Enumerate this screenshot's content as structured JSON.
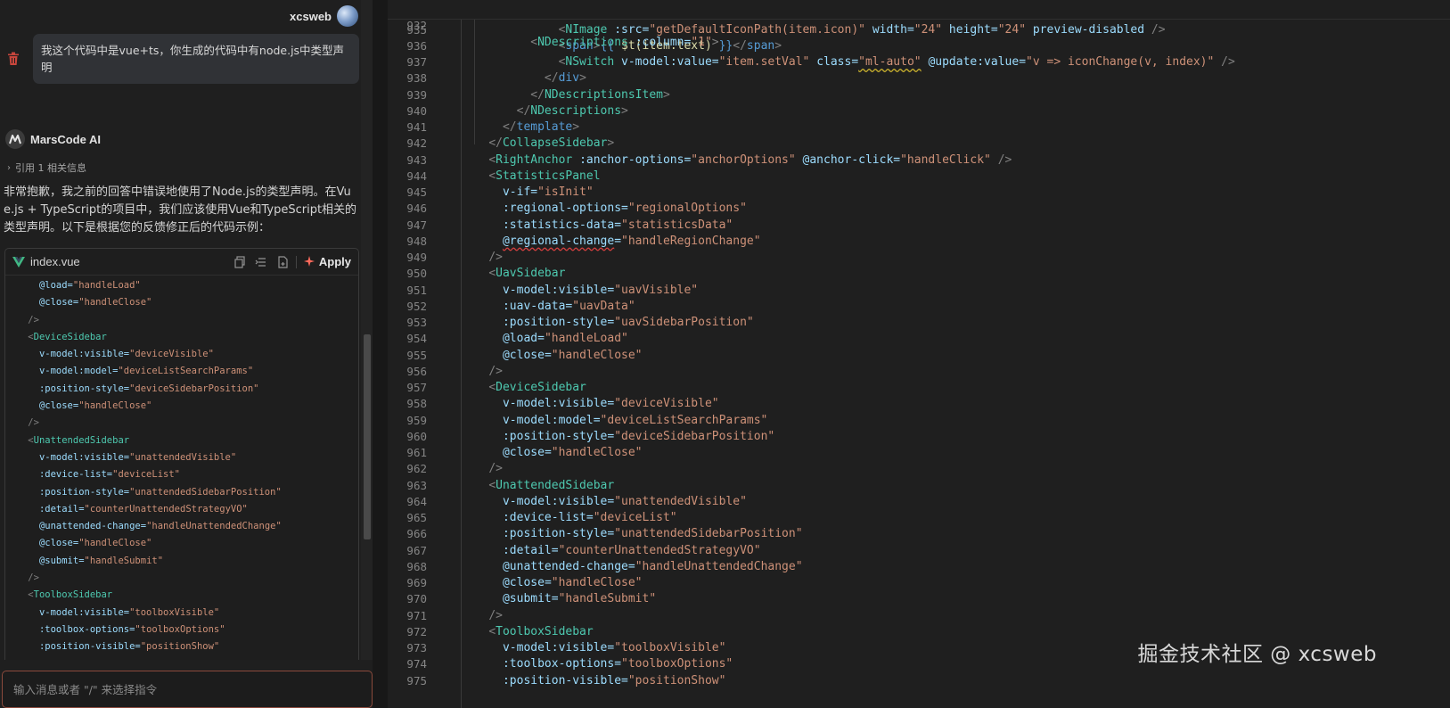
{
  "chat": {
    "user": {
      "name": "xcsweb",
      "message": "我这个代码中是vue+ts，你生成的代码中有node.js中类型声明"
    },
    "assistant": {
      "name": "MarsCode AI",
      "reference": "引用 1 相关信息",
      "reply": "非常抱歉，我之前的回答中错误地使用了Node.js的类型声明。在Vue.js + TypeScript的项目中，我们应该使用Vue和TypeScript相关的类型声明。以下是根据您的反馈修正后的代码示例："
    },
    "code_card": {
      "file_name": "index.vue",
      "apply_label": "Apply",
      "lines": [
        "      @load=\"handleLoad\"",
        "      @close=\"handleClose\"",
        "    />",
        "    <DeviceSidebar",
        "      v-model:visible=\"deviceVisible\"",
        "      v-model:model=\"deviceListSearchParams\"",
        "      :position-style=\"deviceSidebarPosition\"",
        "      @close=\"handleClose\"",
        "    />",
        "    <UnattendedSidebar",
        "      v-model:visible=\"unattendedVisible\"",
        "      :device-list=\"deviceList\"",
        "      :position-style=\"unattendedSidebarPosition\"",
        "      :detail=\"counterUnattendedStrategyVO\"",
        "      @unattended-change=\"handleUnattendedChange\"",
        "      @close=\"handleClose\"",
        "      @submit=\"handleSubmit\"",
        "    />",
        "    <ToolboxSidebar",
        "      v-model:visible=\"toolboxVisible\"",
        "      :toolbox-options=\"toolboxOptions\"",
        "      :position-visible=\"positionShow\""
      ]
    },
    "input_placeholder": "输入消息或者 \"/\" 来选择指令"
  },
  "editor": {
    "sticky": {
      "number": "932",
      "text": "          <NDescriptions :column=\"1\">"
    },
    "lines": [
      {
        "n": "935",
        "t": "              <NImage :src=\"getDefaultIconPath(item.icon)\" width=\"24\" height=\"24\" preview-disabled />"
      },
      {
        "n": "936",
        "t": "              <span>{{ $t(item.text) }}</span>"
      },
      {
        "n": "937",
        "t": "              <NSwitch v-model:value=\"item.setVal\" class=\"ml-auto\" @update:value=\"v => iconChange(v, index)\" />"
      },
      {
        "n": "938",
        "t": "            </div>"
      },
      {
        "n": "939",
        "t": "          </NDescriptionsItem>"
      },
      {
        "n": "940",
        "t": "        </NDescriptions>"
      },
      {
        "n": "941",
        "t": "      </template>"
      },
      {
        "n": "942",
        "t": "    </CollapseSidebar>"
      },
      {
        "n": "943",
        "t": "    <RightAnchor :anchor-options=\"anchorOptions\" @anchor-click=\"handleClick\" />"
      },
      {
        "n": "944",
        "t": "    <StatisticsPanel"
      },
      {
        "n": "945",
        "t": "      v-if=\"isInit\""
      },
      {
        "n": "946",
        "t": "      :regional-options=\"regionalOptions\""
      },
      {
        "n": "947",
        "t": "      :statistics-data=\"statisticsData\""
      },
      {
        "n": "948",
        "t": "      @regional-change=\"handleRegionChange\""
      },
      {
        "n": "949",
        "t": "    />"
      },
      {
        "n": "950",
        "t": "    <UavSidebar"
      },
      {
        "n": "951",
        "t": "      v-model:visible=\"uavVisible\""
      },
      {
        "n": "952",
        "t": "      :uav-data=\"uavData\""
      },
      {
        "n": "953",
        "t": "      :position-style=\"uavSidebarPosition\""
      },
      {
        "n": "954",
        "t": "      @load=\"handleLoad\""
      },
      {
        "n": "955",
        "t": "      @close=\"handleClose\""
      },
      {
        "n": "956",
        "t": "    />"
      },
      {
        "n": "957",
        "t": "    <DeviceSidebar"
      },
      {
        "n": "958",
        "t": "      v-model:visible=\"deviceVisible\""
      },
      {
        "n": "959",
        "t": "      v-model:model=\"deviceListSearchParams\""
      },
      {
        "n": "960",
        "t": "      :position-style=\"deviceSidebarPosition\""
      },
      {
        "n": "961",
        "t": "      @close=\"handleClose\""
      },
      {
        "n": "962",
        "t": "    />"
      },
      {
        "n": "963",
        "t": "    <UnattendedSidebar"
      },
      {
        "n": "964",
        "t": "      v-model:visible=\"unattendedVisible\""
      },
      {
        "n": "965",
        "t": "      :device-list=\"deviceList\""
      },
      {
        "n": "966",
        "t": "      :position-style=\"unattendedSidebarPosition\""
      },
      {
        "n": "967",
        "t": "      :detail=\"counterUnattendedStrategyVO\""
      },
      {
        "n": "968",
        "t": "      @unattended-change=\"handleUnattendedChange\""
      },
      {
        "n": "969",
        "t": "      @close=\"handleClose\""
      },
      {
        "n": "970",
        "t": "      @submit=\"handleSubmit\""
      },
      {
        "n": "971",
        "t": "    />"
      },
      {
        "n": "972",
        "t": "    <ToolboxSidebar"
      },
      {
        "n": "973",
        "t": "      v-model:visible=\"toolboxVisible\""
      },
      {
        "n": "974",
        "t": "      :toolbox-options=\"toolboxOptions\""
      },
      {
        "n": "975",
        "t": "      :position-visible=\"positionShow\""
      }
    ]
  },
  "watermark": "掘金技术社区 @ xcsweb",
  "colors": {
    "tag_bracket": "#808080",
    "component": "#4ec9b0",
    "attribute": "#9cdcfe",
    "string": "#ce9178",
    "html_tag": "#569cd6",
    "accent_input_border": "#8b4a3c"
  }
}
